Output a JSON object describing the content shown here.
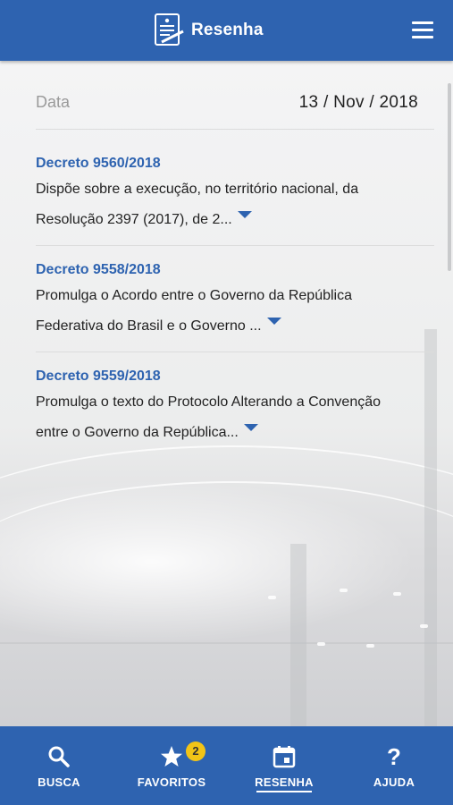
{
  "header": {
    "title": "Resenha",
    "menu_icon": "hamburger-menu-icon",
    "logo_icon": "document-pen-icon"
  },
  "date": {
    "label": "Data",
    "value": "13 / Nov / 2018"
  },
  "items": [
    {
      "title": "Decreto 9560/2018",
      "line1": "Dispõe sobre a execução, no território nacional, da",
      "line2": "Resolução 2397 (2017), de 2..."
    },
    {
      "title": "Decreto 9558/2018",
      "line1": "Promulga o Acordo entre o Governo da República",
      "line2": "Federativa do Brasil e o Governo ..."
    },
    {
      "title": "Decreto 9559/2018",
      "line1": "Promulga o texto do Protocolo Alterando a Convenção",
      "line2": "entre o Governo da República..."
    }
  ],
  "bottom_nav": {
    "busca": {
      "label": "BUSCA",
      "icon": "search-icon"
    },
    "favoritos": {
      "label": "FAVORITOS",
      "icon": "star-icon",
      "badge": "2"
    },
    "resenha": {
      "label": "RESENHA",
      "icon": "calendar-icon",
      "active": true
    },
    "ajuda": {
      "label": "AJUDA",
      "icon": "question-mark-icon"
    }
  },
  "colors": {
    "primary": "#2e63b0",
    "badge": "#f2c417"
  }
}
